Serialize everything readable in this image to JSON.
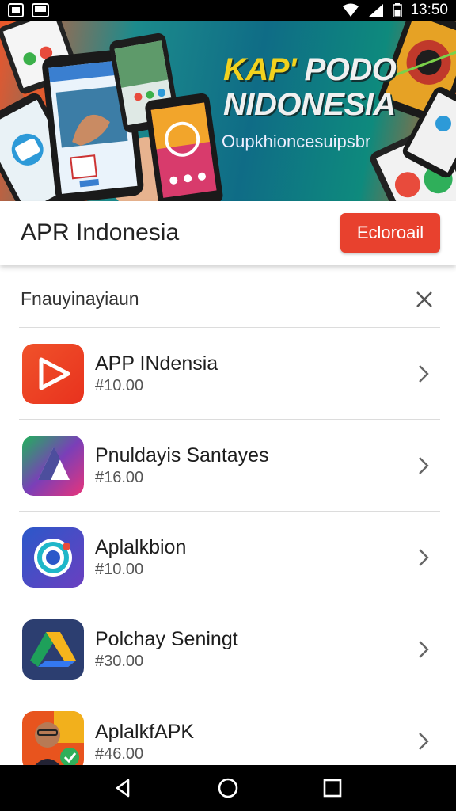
{
  "status_bar": {
    "time": "13:50"
  },
  "banner": {
    "title_line1_a": "KAP'",
    "title_line1_b": " PODO",
    "title_line2": "NIDONESIA",
    "subtitle": "Oupkhioncesuipsbr"
  },
  "header": {
    "title": "APR Indonesia",
    "button_label": "Ecloroail"
  },
  "filter": {
    "label": "Fnauyinayiaun"
  },
  "apps": [
    {
      "name": "APP INdensia",
      "price": "#10.00",
      "icon": "play-icon"
    },
    {
      "name": "Pnuldayis Santayes",
      "price": "#16.00",
      "icon": "drive-triangle-icon"
    },
    {
      "name": "Aplalkbion",
      "price": "#10.00",
      "icon": "ring-icon"
    },
    {
      "name": "Polchay Seningt",
      "price": "#30.00",
      "icon": "drive-triangle-icon"
    },
    {
      "name": "AplalkfAPK",
      "price": "#46.00",
      "icon": "avatar-icon"
    }
  ],
  "colors": {
    "accent": "#e8412e",
    "status_bar": "#000000",
    "nav_bar": "#000000"
  }
}
